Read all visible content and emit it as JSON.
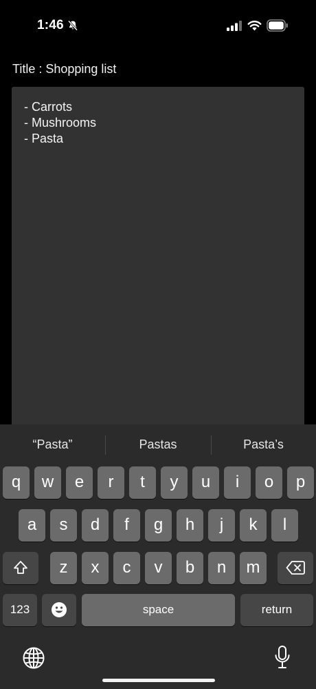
{
  "status_bar": {
    "time": "1:46",
    "icons": [
      "bell-slash-icon",
      "cellular-signal-icon",
      "wifi-icon",
      "battery-icon"
    ]
  },
  "title": {
    "label": "Title : ",
    "value": "Shopping list"
  },
  "note": {
    "lines": [
      "- Carrots",
      "- Mushrooms",
      "- Pasta"
    ]
  },
  "keyboard": {
    "suggestions": [
      "“Pasta”",
      "Pastas",
      "Pasta’s"
    ],
    "row1": [
      "q",
      "w",
      "e",
      "r",
      "t",
      "y",
      "u",
      "i",
      "o",
      "p"
    ],
    "row2": [
      "a",
      "s",
      "d",
      "f",
      "g",
      "h",
      "j",
      "k",
      "l"
    ],
    "row3": [
      "z",
      "x",
      "c",
      "v",
      "b",
      "n",
      "m"
    ],
    "numbers_label": "123",
    "space_label": "space",
    "return_label": "return",
    "icons": [
      "shift-icon",
      "delete-icon",
      "emoji-icon",
      "globe-icon",
      "microphone-icon"
    ]
  },
  "colors": {
    "background": "#000000",
    "note_background": "#323232",
    "keyboard_background": "#2b2b2b",
    "key": "#6b6b6b",
    "function_key": "#464646"
  }
}
